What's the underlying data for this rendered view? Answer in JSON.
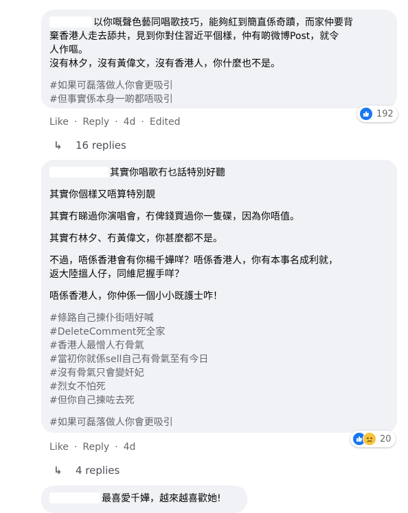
{
  "comment1": {
    "lines": [
      "以你嘅聲色藝同唱歌技巧，能夠紅到簡直係奇蹟，而家仲要背",
      "棄香港人走去舔共，見到你對住習近平個樣，仲有啲微博Post，就令",
      "人作嘔。",
      "沒有林夕，沒有黃偉文，沒有香港人，你什麼也不是。"
    ],
    "tags": [
      "#如果可磊落做人你會更吸引",
      "#但事實係本身一啲都唔吸引"
    ],
    "actions": {
      "like": "Like",
      "reply": "Reply",
      "time": "4d",
      "edited": "Edited"
    },
    "reactions": {
      "icons": [
        "like-icon"
      ],
      "count": "192"
    },
    "replies_label": "16 replies"
  },
  "comment2": {
    "first_line": "其實你唱歌冇乜話特別好聽",
    "paragraphs": [
      [
        "其實你個樣又唔算特別靚"
      ],
      [
        "其實冇睇過你演唱會，冇俾錢買過你一隻碟，因為你唔值。"
      ],
      [
        "其實冇林夕、冇黃偉文，你甚麼都不是。"
      ],
      [
        "不過，唔係香港會有你楊千嬅咩？唔係香港人，你有本事名成利就，",
        "返大陸搵人仔，同維尼握手咩？"
      ],
      [
        "唔係香港人，你仲係一個小小既護士咋！"
      ]
    ],
    "tags": [
      "#條路自己揀仆街唔好喊",
      "#DeleteComment死全家",
      "#香港人最憎人冇骨氣",
      "#當初你就係sell自己有骨氣至有今日",
      "#沒有骨氣只會變奸妃",
      "#烈女不怕死",
      "#但你自己揀咗去死"
    ],
    "last_tag": "#如果可磊落做人你會更吸引",
    "actions": {
      "like": "Like",
      "reply": "Reply",
      "time": "4d"
    },
    "reactions": {
      "icons": [
        "like-icon",
        "sad-icon"
      ],
      "count": "20"
    },
    "replies_label": "4 replies"
  },
  "comment3": {
    "text": "最喜愛千嬅，越來越喜歡她!"
  },
  "colors": {
    "bubble": "#f0f2f5",
    "like": "#1877f2",
    "muted": "#65676b"
  }
}
